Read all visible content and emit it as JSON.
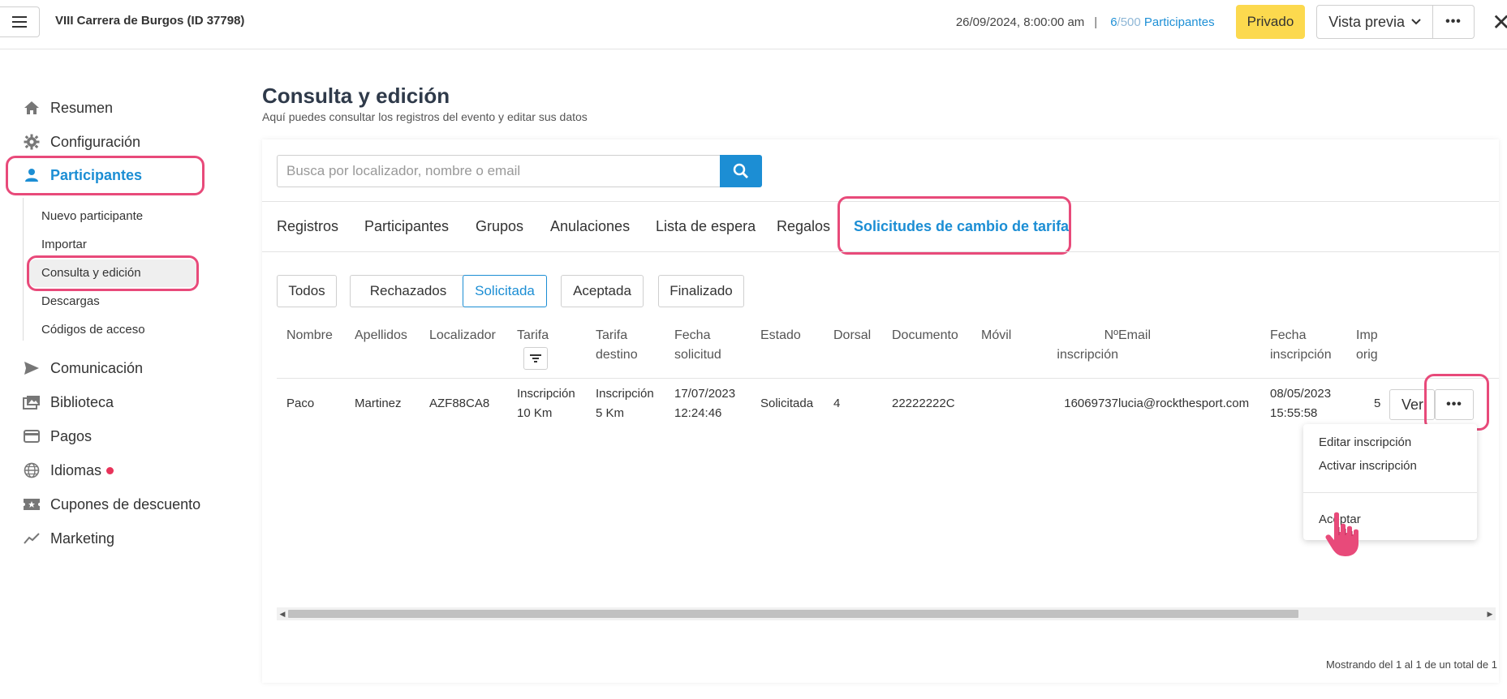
{
  "header": {
    "event_title": "VIII Carrera de Burgos (ID 37798)",
    "date": "26/09/2024, 8:00:00 am",
    "separator": "|",
    "participants_current": "6",
    "participants_max": "/500",
    "participants_label": "Participantes",
    "status_badge": "Privado",
    "preview_label": "Vista previa",
    "more_label": "•••",
    "close_label": "✕"
  },
  "sidebar": {
    "items": [
      {
        "label": "Resumen",
        "icon": "home-icon"
      },
      {
        "label": "Configuración",
        "icon": "gear-icon"
      },
      {
        "label": "Participantes",
        "icon": "person-icon"
      },
      {
        "label": "Comunicación",
        "icon": "send-icon"
      },
      {
        "label": "Biblioteca",
        "icon": "images-icon"
      },
      {
        "label": "Pagos",
        "icon": "credit-card-icon"
      },
      {
        "label": "Idiomas",
        "icon": "globe-icon"
      },
      {
        "label": "Cupones de descuento",
        "icon": "ticket-icon"
      },
      {
        "label": "Marketing",
        "icon": "trend-icon"
      }
    ],
    "sub_items": [
      {
        "label": "Nuevo participante"
      },
      {
        "label": "Importar"
      },
      {
        "label": "Consulta y edición"
      },
      {
        "label": "Descargas"
      },
      {
        "label": "Códigos de acceso"
      }
    ]
  },
  "main": {
    "title": "Consulta y edición",
    "subtitle": "Aquí puedes consultar los registros del evento y editar sus datos",
    "search_placeholder": "Busca por localizador, nombre o email",
    "tabs": [
      {
        "label": "Registros"
      },
      {
        "label": "Participantes"
      },
      {
        "label": "Grupos"
      },
      {
        "label": "Anulaciones"
      },
      {
        "label": "Lista de espera"
      },
      {
        "label": "Regalos"
      },
      {
        "label": "Solicitudes de cambio de tarifa"
      }
    ],
    "filters": [
      {
        "label": "Todos"
      },
      {
        "label": "Rechazados"
      },
      {
        "label": "Solicitada"
      },
      {
        "label": "Aceptada"
      },
      {
        "label": "Finalizado"
      }
    ],
    "columns": {
      "nombre": "Nombre",
      "apellidos": "Apellidos",
      "localizador": "Localizador",
      "tarifa": "Tarifa",
      "tarifa_destino_1": "Tarifa",
      "tarifa_destino_2": "destino",
      "fecha_solicitud_1": "Fecha",
      "fecha_solicitud_2": "solicitud",
      "estado": "Estado",
      "dorsal": "Dorsal",
      "documento": "Documento",
      "movil": "Móvil",
      "n_inscripcion_1": "Nº",
      "n_inscripcion_2": "inscripción",
      "email": "Email",
      "fecha_inscripcion_1": "Fecha",
      "fecha_inscripcion_2": "inscripción",
      "importe_1": "Imp",
      "importe_2": "orig"
    },
    "row": {
      "nombre": "Paco",
      "apellidos": "Martinez",
      "localizador": "AZF88CA8",
      "tarifa_1": "Inscripción",
      "tarifa_2": "10 Km",
      "tarifa_destino_1": "Inscripción",
      "tarifa_destino_2": "5 Km",
      "fecha_solicitud_1": "17/07/2023",
      "fecha_solicitud_2": "12:24:46",
      "estado": "Solicitada",
      "dorsal": "4",
      "documento": "22222222C",
      "movil": "",
      "n_inscripcion": "16069737",
      "email": "lucia@rockthesport.com",
      "fecha_inscripcion_1": "08/05/2023",
      "fecha_inscripcion_2": "15:55:58",
      "importe": "5",
      "ver_label": "Ver",
      "more_label": "•••"
    },
    "dropdown": {
      "items": [
        {
          "label": "Editar inscripción"
        },
        {
          "label": "Activar inscripción"
        },
        {
          "label": "Aceptar"
        }
      ]
    },
    "footer_count": "Mostrando del 1 al 1 de un total de 1"
  },
  "colors": {
    "accent": "#1c8ed4",
    "highlight": "#e84a7a",
    "badge": "#fcd94e",
    "notification_dot": "#e8335a"
  }
}
